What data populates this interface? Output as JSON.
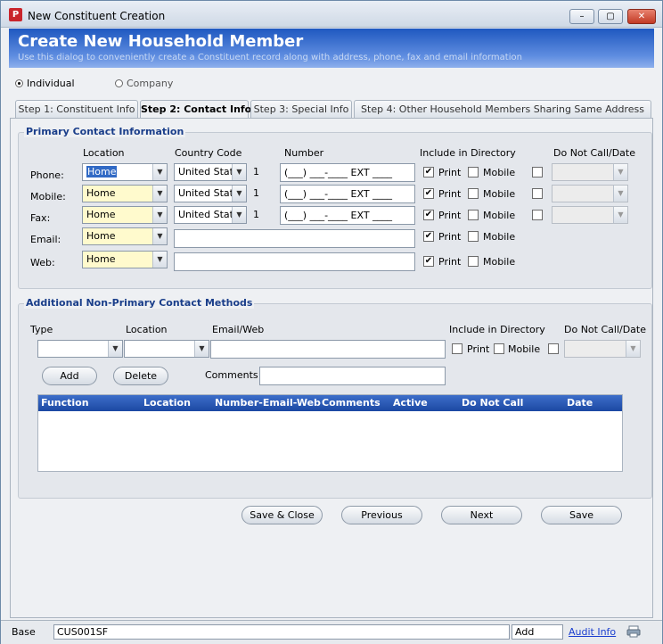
{
  "window": {
    "title": "New Constituent Creation",
    "app_icon_glyph": "P",
    "minimize_glyph": "–",
    "maximize_glyph": "▢",
    "close_glyph": "✕"
  },
  "header": {
    "title": "Create New Household Member",
    "subtitle": "Use this dialog to conveniently create a Constituent record along with address, phone, fax and email information"
  },
  "constituent_type": {
    "individual_label": "Individual",
    "company_label": "Company",
    "selected": "Individual"
  },
  "tabs": [
    {
      "label": "Step 1: Constituent Info"
    },
    {
      "label": "Step 2: Contact Info"
    },
    {
      "label": "Step 3: Special Info"
    },
    {
      "label": "Step 4: Other Household Members Sharing Same Address"
    }
  ],
  "primary": {
    "title": "Primary Contact Information",
    "col_location": "Location",
    "col_country": "Country Code",
    "col_number": "Number",
    "col_include": "Include in Directory",
    "col_dnc": "Do Not Call/Date",
    "rows": [
      {
        "label": "Phone:",
        "location": "Home",
        "country": "United Stat",
        "code": "1",
        "number": "(___) ___-____ EXT ____",
        "print": "✔",
        "mobile": ""
      },
      {
        "label": "Mobile:",
        "location": "Home",
        "country": "United Stat",
        "code": "1",
        "number": "(___) ___-____ EXT ____",
        "print": "✔",
        "mobile": ""
      },
      {
        "label": "Fax:",
        "location": "Home",
        "country": "United Stat",
        "code": "1",
        "number": "(___) ___-____ EXT ____",
        "print": "✔",
        "mobile": ""
      },
      {
        "label": "Email:",
        "location": "Home",
        "print": "✔",
        "mobile": ""
      },
      {
        "label": "Web:",
        "location": "Home",
        "print": "✔",
        "mobile": ""
      }
    ],
    "print_label": "Print",
    "mobile_label": "Mobile"
  },
  "additional": {
    "title": "Additional Non-Primary Contact Methods",
    "col_type": "Type",
    "col_location": "Location",
    "col_email": "Email/Web",
    "col_include": "Include in Directory",
    "col_dnc": "Do Not Call/Date",
    "print_label": "Print",
    "mobile_label": "Mobile",
    "add_label": "Add",
    "delete_label": "Delete",
    "comments_label": "Comments",
    "grid_columns": [
      "Function",
      "Location",
      "Number-Email-Web",
      "Comments",
      "Active",
      "Do Not Call",
      "Date"
    ]
  },
  "footer_buttons": {
    "save_close": "Save & Close",
    "previous": "Previous",
    "next": "Next",
    "save": "Save"
  },
  "statusbar": {
    "base": "Base",
    "screen_code": "CUS001SF",
    "mode": "Add",
    "audit_info": "Audit Info"
  },
  "colors": {
    "header_blue": "#1f58c0",
    "required_yellow": "#fffacd",
    "close_red": "#c23a25",
    "group_title_blue": "#1a3e8a"
  }
}
